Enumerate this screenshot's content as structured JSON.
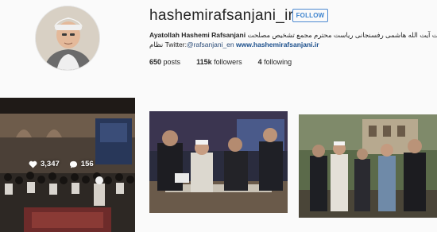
{
  "profile": {
    "username": "hashemirafsanjani_ir",
    "follow_label": "FOLLOW",
    "full_name": "Ayatollah Hashemi Rafsanjani",
    "bio_text": "حضرت آیت الله هاشمی رفسنجانی ریاست محترم مجمع تشخیص مصلحت",
    "bio_line2_prefix": "نظام Twitter:",
    "twitter_handle": "@rafsanjani_en",
    "website": "www.hashemirafsanjani.ir"
  },
  "stats": {
    "posts_count": "650",
    "posts_label": "posts",
    "followers_count": "115k",
    "followers_label": "followers",
    "following_count": "4",
    "following_label": "following"
  },
  "posts": [
    {
      "likes": "3,347",
      "comments": "156",
      "hover": true
    },
    {
      "hover": false
    },
    {
      "hover": false
    }
  ],
  "colors": {
    "follow_blue": "#3e84cf",
    "link_blue": "#1b4f8c",
    "background": "#fafafa"
  },
  "icons": {
    "like": "heart-icon",
    "comment": "comment-bubble-icon"
  }
}
